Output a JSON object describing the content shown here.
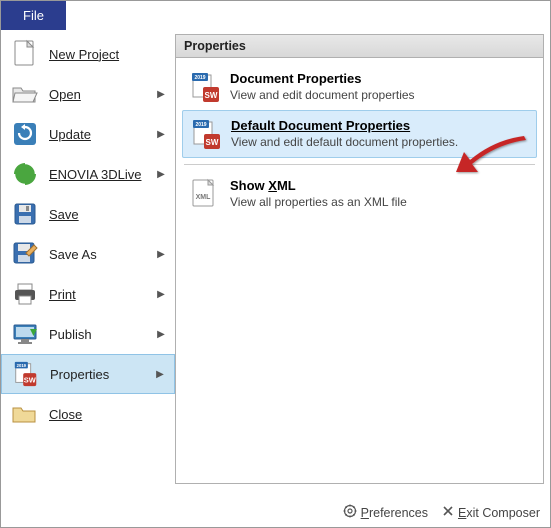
{
  "tab": {
    "file": "File"
  },
  "menu": {
    "new_project": "New Project",
    "open": "Open",
    "update": "Update",
    "enovia": "ENOVIA 3DLive",
    "save": "Save",
    "save_as": "Save As",
    "print": "Print",
    "publish": "Publish",
    "properties": "Properties",
    "close": "Close"
  },
  "panel": {
    "header": "Properties",
    "doc_props": {
      "title": "Document Properties",
      "desc": "View and edit document properties"
    },
    "default_props": {
      "title": "Default Document Properties",
      "desc": "View and edit default document properties."
    },
    "show_xml": {
      "title": "Show XML",
      "desc": "View all properties as an XML file"
    }
  },
  "footer": {
    "preferences": "Preferences",
    "exit": "Exit Composer"
  },
  "icons": {
    "badge_year": "2019"
  }
}
